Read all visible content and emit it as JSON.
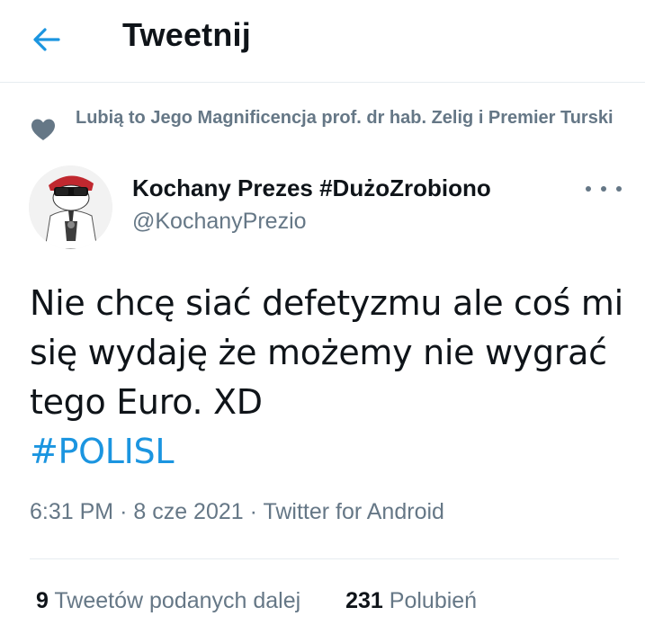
{
  "header": {
    "title": "Tweetnij",
    "back_icon": "arrow-left-icon"
  },
  "liked_by": {
    "text": "Lubią to Jego Magnificencja prof. dr hab. Zelig i Premier Turski",
    "icon": "heart-icon"
  },
  "author": {
    "name": "Kochany Prezes #DużoZrobiono",
    "handle": "@KochanyPrezio"
  },
  "tweet": {
    "text": "Nie chcę siać defetyzmu ale coś mi się wydaję że możemy nie wygrać tego Euro. XD",
    "hashtag": "#POLISL"
  },
  "meta": {
    "time": "6:31 PM",
    "separator": "·",
    "date": "8 cze 2021",
    "source": "Twitter for Android"
  },
  "stats": {
    "retweets_count": "9",
    "retweets_label": "Tweetów podanych dalej",
    "likes_count": "231",
    "likes_label": "Polubień"
  },
  "colors": {
    "accent": "#1b95e0",
    "secondary_text": "#657786",
    "primary_text": "#0f1419",
    "divider": "#e6ecf0"
  }
}
